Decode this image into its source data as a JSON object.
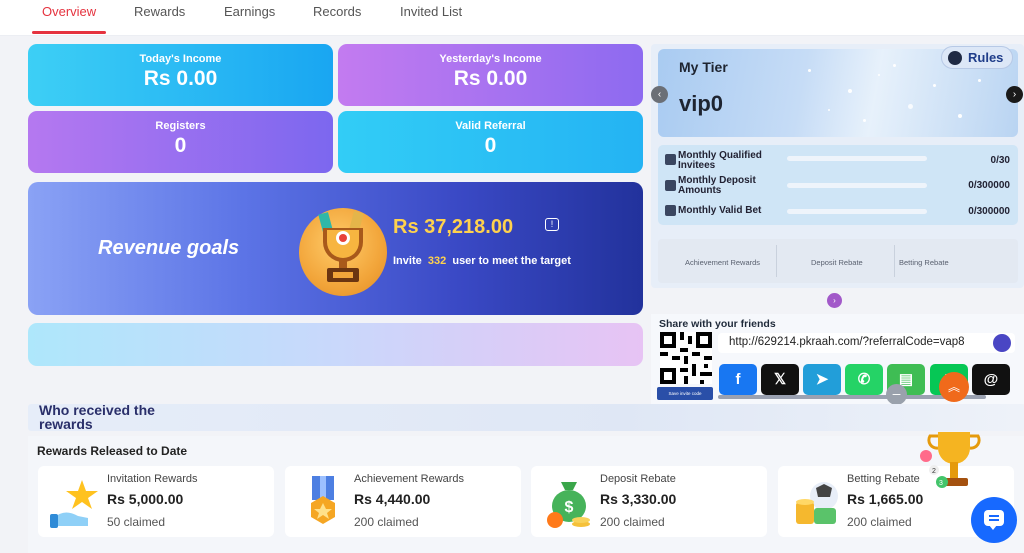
{
  "tabs": [
    "Overview",
    "Rewards",
    "Earnings",
    "Records",
    "Invited List"
  ],
  "active_tab": "Overview",
  "stats": {
    "today_income": {
      "label": "Today's Income",
      "value": "Rs  0.00"
    },
    "yesterday_income": {
      "label": "Yesterday's Income",
      "value": "Rs  0.00"
    },
    "registers": {
      "label": "Registers",
      "value": "0"
    },
    "valid_referral": {
      "label": "Valid Referral",
      "value": "0"
    }
  },
  "revenue": {
    "title": "Revenue goals",
    "amount": "Rs  37,218.00",
    "invite_prefix": "Invite",
    "invite_count": "332",
    "invite_suffix": "user to meet the target"
  },
  "tier": {
    "title": "My Tier",
    "level": "vip0",
    "rules_label": "Rules",
    "stats": [
      {
        "label": "Monthly Qualified Invitees",
        "value": "0/30",
        "progress": 0
      },
      {
        "label": "Monthly Deposit Amounts",
        "value": "0/300000",
        "progress": 0
      },
      {
        "label": "Monthly Valid Bet",
        "value": "0/300000",
        "progress": 0
      }
    ],
    "tabs": [
      "Achievement Rewards",
      "Deposit Rebate",
      "Betting Rebate"
    ]
  },
  "share": {
    "title": "Share with your friends",
    "url": "http://629214.pkraah.com/?referralCode=vap8",
    "qr_caption": "Save invite code",
    "socials": [
      {
        "name": "facebook",
        "glyph": "f",
        "color": "#1877f2"
      },
      {
        "name": "x",
        "glyph": "𝕏",
        "color": "#111111"
      },
      {
        "name": "telegram",
        "glyph": "➤",
        "color": "#229ed9"
      },
      {
        "name": "whatsapp",
        "glyph": "✆",
        "color": "#25d366"
      },
      {
        "name": "sms",
        "glyph": "▤",
        "color": "#3fbd54"
      },
      {
        "name": "line",
        "glyph": "L",
        "color": "#06c755"
      },
      {
        "name": "threads",
        "glyph": "@",
        "color": "#111111"
      }
    ]
  },
  "who_received": "Who received the rewards",
  "rewards": {
    "title": "Rewards Released to Date",
    "items": [
      {
        "name": "Invitation Rewards",
        "amount": "Rs  5,000.00",
        "claimed": "50 claimed"
      },
      {
        "name": "Achievement Rewards",
        "amount": "Rs  4,440.00",
        "claimed": "200 claimed"
      },
      {
        "name": "Deposit Rebate",
        "amount": "Rs  3,330.00",
        "claimed": "200 claimed"
      },
      {
        "name": "Betting Rebate",
        "amount": "Rs  1,665.00",
        "claimed": "200 claimed"
      }
    ]
  },
  "colors": {
    "accent": "#e5333f",
    "brand": "#1769ff"
  }
}
